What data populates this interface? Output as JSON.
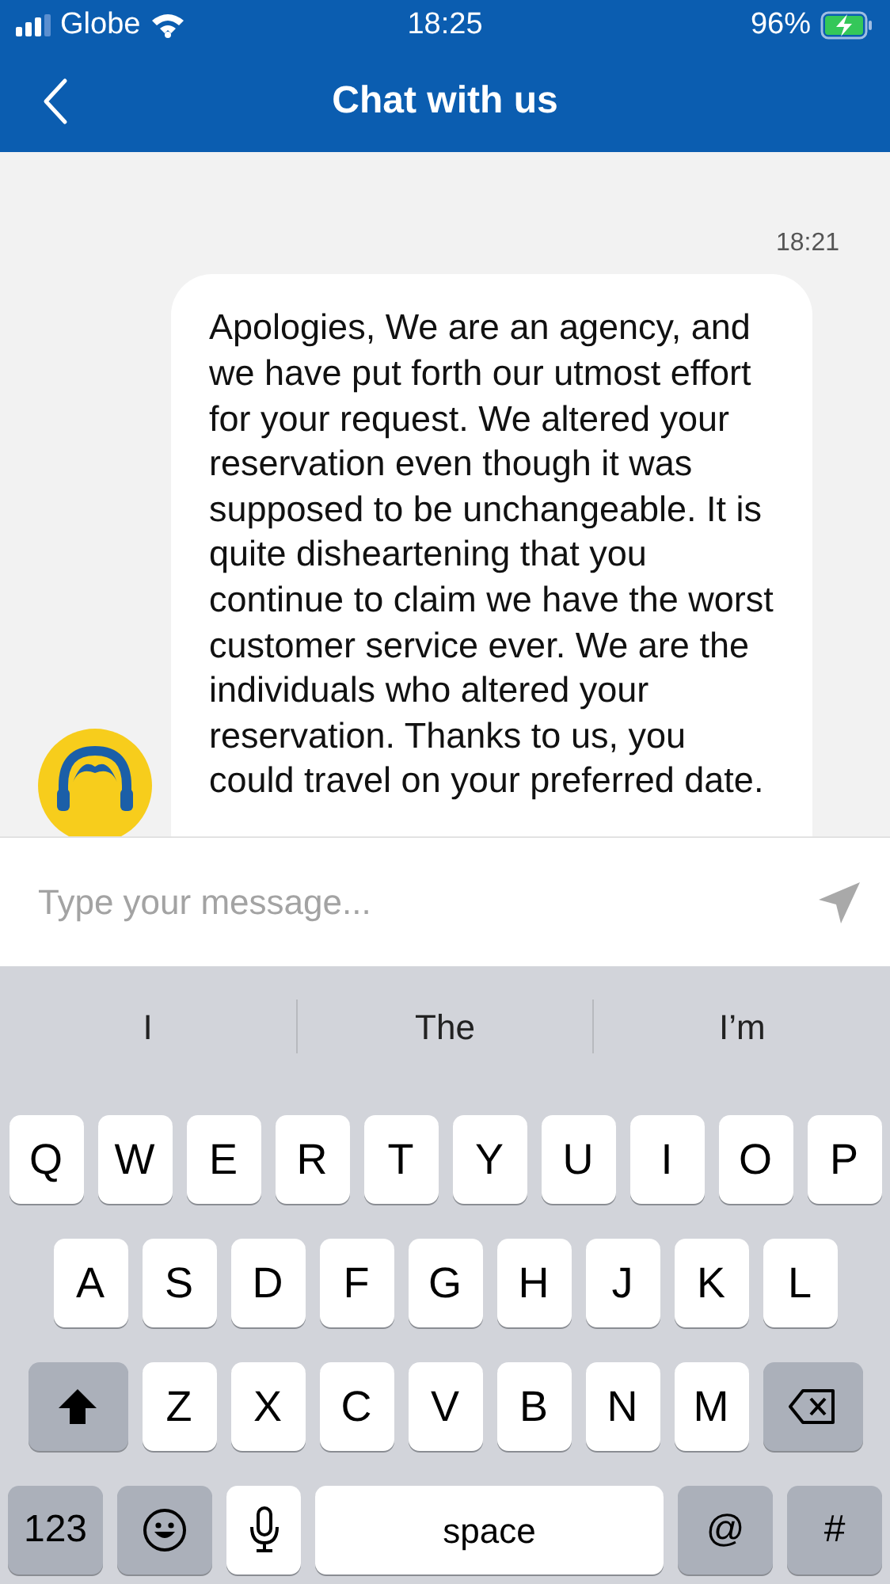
{
  "status_bar": {
    "carrier": "Globe",
    "time": "18:25",
    "battery": "96%",
    "charging": true
  },
  "header": {
    "title": "Chat with us"
  },
  "messages": [
    {
      "time": "18:21",
      "text": "Apologies, We are an agency, and we have put forth our utmost effort for your request. We altered your reservation even though it was supposed to be unchangeable. It is quite disheartening that you continue to claim we have the worst customer service ever. We are the individuals who altered your reservation. Thanks to us, you could travel on your preferred date."
    }
  ],
  "composer": {
    "placeholder": "Type your message..."
  },
  "keyboard": {
    "suggestions": [
      "I",
      "The",
      "I’m"
    ],
    "rows": [
      [
        {
          "kind": "char",
          "label": "Q"
        },
        {
          "kind": "char",
          "label": "W"
        },
        {
          "kind": "char",
          "label": "E"
        },
        {
          "kind": "char",
          "label": "R"
        },
        {
          "kind": "char",
          "label": "T"
        },
        {
          "kind": "char",
          "label": "Y"
        },
        {
          "kind": "char",
          "label": "U"
        },
        {
          "kind": "char",
          "label": "I"
        },
        {
          "kind": "char",
          "label": "O"
        },
        {
          "kind": "char",
          "label": "P"
        }
      ],
      [
        {
          "kind": "char",
          "label": "A"
        },
        {
          "kind": "char",
          "label": "S"
        },
        {
          "kind": "char",
          "label": "D"
        },
        {
          "kind": "char",
          "label": "F"
        },
        {
          "kind": "char",
          "label": "G"
        },
        {
          "kind": "char",
          "label": "H"
        },
        {
          "kind": "char",
          "label": "J"
        },
        {
          "kind": "char",
          "label": "K"
        },
        {
          "kind": "char",
          "label": "L"
        }
      ],
      [
        {
          "kind": "shift"
        },
        {
          "kind": "char",
          "label": "Z"
        },
        {
          "kind": "char",
          "label": "X"
        },
        {
          "kind": "char",
          "label": "C"
        },
        {
          "kind": "char",
          "label": "V"
        },
        {
          "kind": "char",
          "label": "B"
        },
        {
          "kind": "char",
          "label": "N"
        },
        {
          "kind": "char",
          "label": "M"
        },
        {
          "kind": "backspace"
        }
      ],
      [
        {
          "kind": "fn",
          "label": "123"
        },
        {
          "kind": "emoji"
        },
        {
          "kind": "mic"
        },
        {
          "kind": "space",
          "label": "space"
        },
        {
          "kind": "fn",
          "label": "@"
        },
        {
          "kind": "fn",
          "label": "#"
        }
      ]
    ]
  }
}
